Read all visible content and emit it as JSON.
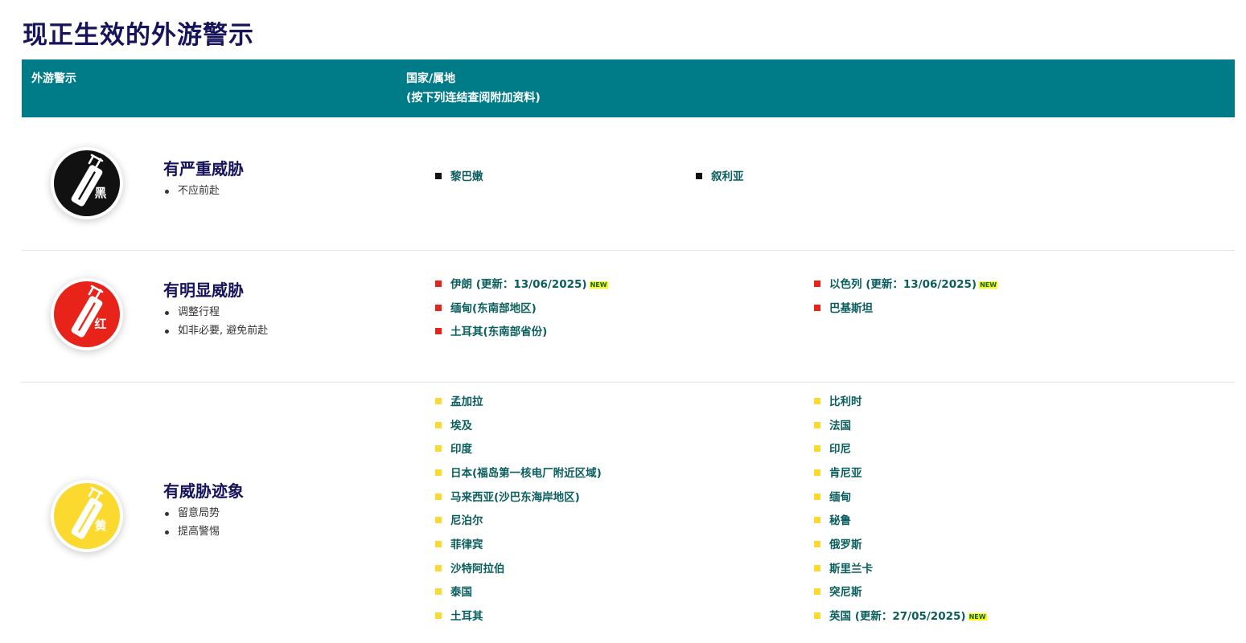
{
  "page_title": "现正生效的外游警示",
  "table_header": {
    "col1": "外游警示",
    "col2_line1": "国家/属地",
    "col2_line2": "(按下列连结查阅附加资料)"
  },
  "levels": [
    {
      "color": "#000000",
      "icon_char": "黑",
      "title": "有严重威胁",
      "notes": [
        "不应前赴"
      ],
      "countries": [
        {
          "name": "黎巴嫩"
        },
        {
          "name": "叙利亚"
        }
      ]
    },
    {
      "color": "#e8231a",
      "icon_char": "红",
      "title": "有明显威胁",
      "notes": [
        "调整行程",
        "如非必要, 避免前赴"
      ],
      "countries": [
        {
          "name": "伊朗 (更新：13/06/2025)",
          "badge": "NEW"
        },
        {
          "name": "以色列 (更新：13/06/2025)",
          "badge": "NEW"
        },
        {
          "name": "缅甸(东南部地区)"
        },
        {
          "name": "巴基斯坦"
        },
        {
          "name": "土耳其(东南部省份)"
        }
      ]
    },
    {
      "color": "#fbd92f",
      "icon_char": "黄",
      "title": "有威胁迹象",
      "notes": [
        "留意局势",
        "提高警惕"
      ],
      "countries": [
        {
          "name": "孟加拉"
        },
        {
          "name": "埃及"
        },
        {
          "name": "印度"
        },
        {
          "name": "日本(福岛第一核电厂附近区域)"
        },
        {
          "name": "马来西亚(沙巴东海岸地区)"
        },
        {
          "name": "尼泊尔"
        },
        {
          "name": "菲律宾"
        },
        {
          "name": "沙特阿拉伯"
        },
        {
          "name": "泰国"
        },
        {
          "name": "土耳其"
        },
        {
          "name": "比利时"
        },
        {
          "name": "法国"
        },
        {
          "name": "印尼"
        },
        {
          "name": "肯尼亚"
        },
        {
          "name": "缅甸"
        },
        {
          "name": "秘鲁"
        },
        {
          "name": "俄罗斯"
        },
        {
          "name": "斯里兰卡"
        },
        {
          "name": "突尼斯"
        },
        {
          "name": "英国 (更新：27/05/2025)",
          "badge": "NEW"
        }
      ]
    }
  ]
}
